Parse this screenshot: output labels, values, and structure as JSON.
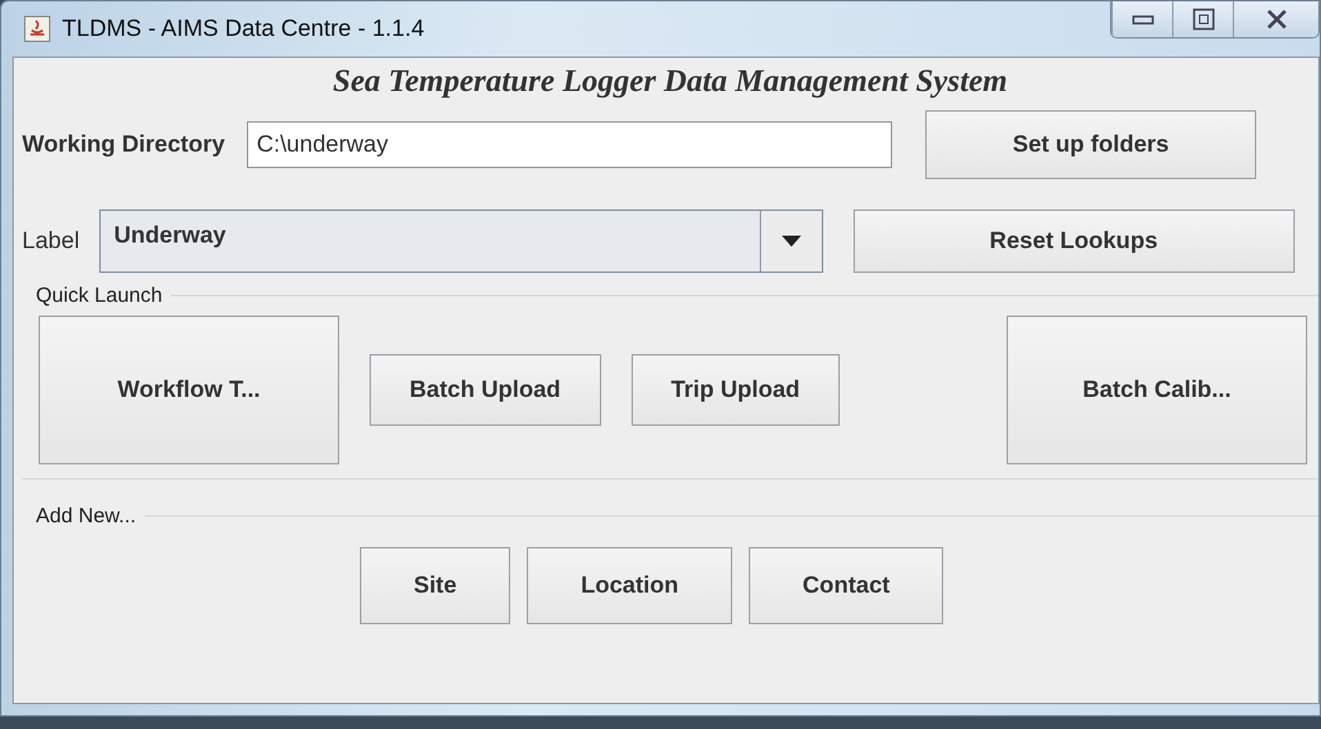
{
  "window": {
    "title": "TLDMS - AIMS Data Centre - 1.1.4"
  },
  "heading": "Sea Temperature Logger Data Management System",
  "working_directory": {
    "label": "Working Directory",
    "value": "C:\\underway",
    "button": "Set up folders"
  },
  "label_row": {
    "label": "Label",
    "value": "Underway",
    "button": "Reset Lookups"
  },
  "quick_launch": {
    "title": "Quick Launch",
    "buttons": [
      {
        "label": "Workflow T...",
        "kind": "large"
      },
      {
        "label": "Batch Upload",
        "kind": "small"
      },
      {
        "label": "Trip Upload",
        "kind": "small"
      },
      {
        "label": "Batch Calib...",
        "kind": "large"
      }
    ]
  },
  "add_new": {
    "title": "Add New...",
    "buttons": [
      "Site",
      "Location",
      "Contact"
    ]
  }
}
